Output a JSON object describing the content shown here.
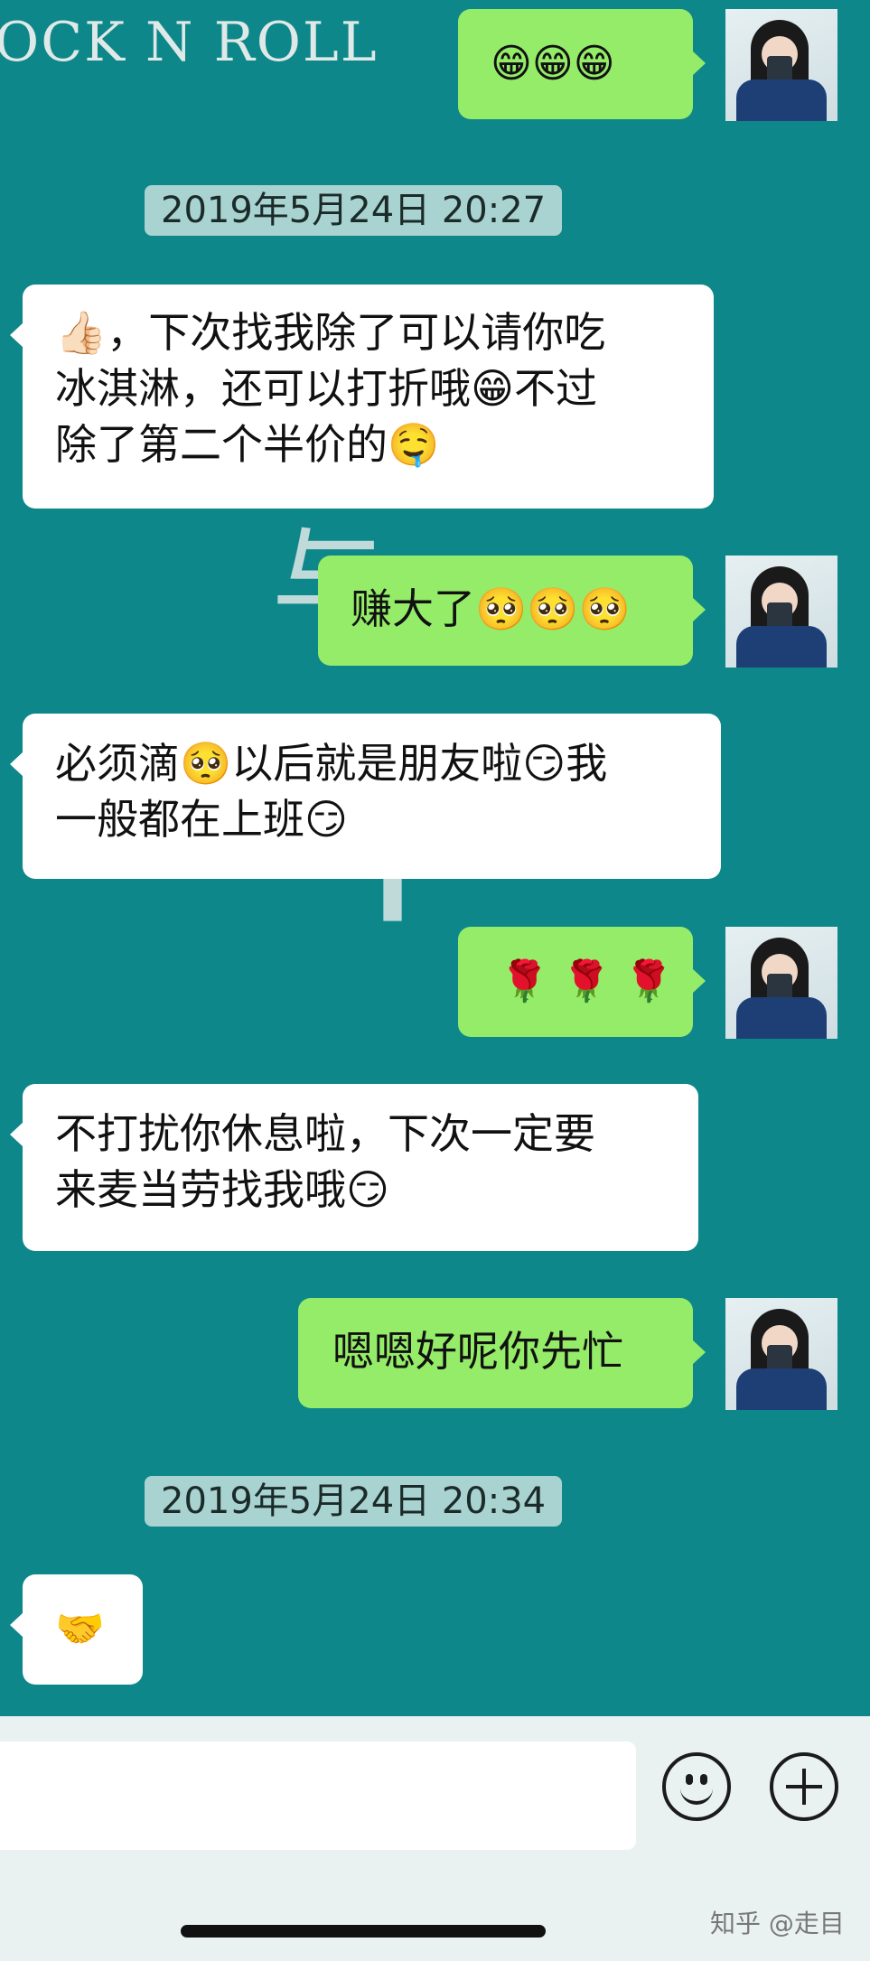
{
  "wallpaper": {
    "top_text": "OCK N ROLL",
    "glyph_1": "与",
    "glyph_2": "平"
  },
  "messages": [
    {
      "dir": "out",
      "text": "😁😁😁"
    },
    {
      "type": "time",
      "text": "2019年5月24日 20:27"
    },
    {
      "dir": "in",
      "lines": [
        "👍🏻，下次找我除了可以请你吃",
        "冰淇淋，还可以打折哦😁不过",
        "除了第二个半价的🤤"
      ]
    },
    {
      "dir": "out",
      "text": "赚大了🥺🥺🥺"
    },
    {
      "dir": "in",
      "lines": [
        "必须滴🥺以后就是朋友啦😏我",
        "一般都在上班😏"
      ]
    },
    {
      "dir": "out",
      "text": "🌹 🌹 🌹"
    },
    {
      "dir": "in",
      "lines": [
        "不打扰你休息啦，下次一定要",
        "来麦当劳找我哦😏"
      ]
    },
    {
      "dir": "out",
      "text": "嗯嗯好呢你先忙"
    },
    {
      "type": "time",
      "text": "2019年5月24日 20:34"
    },
    {
      "dir": "in",
      "text": "🤝"
    }
  ],
  "input": {
    "placeholder": ""
  },
  "icons": {
    "emoji_button": "smiley-icon",
    "plus_button": "plus-icon"
  },
  "watermark": "知乎 @走目",
  "colors": {
    "background": "#0e878a",
    "incoming": "#ffffff",
    "outgoing": "#95ec69",
    "timestamp": "#a9d3d0"
  }
}
